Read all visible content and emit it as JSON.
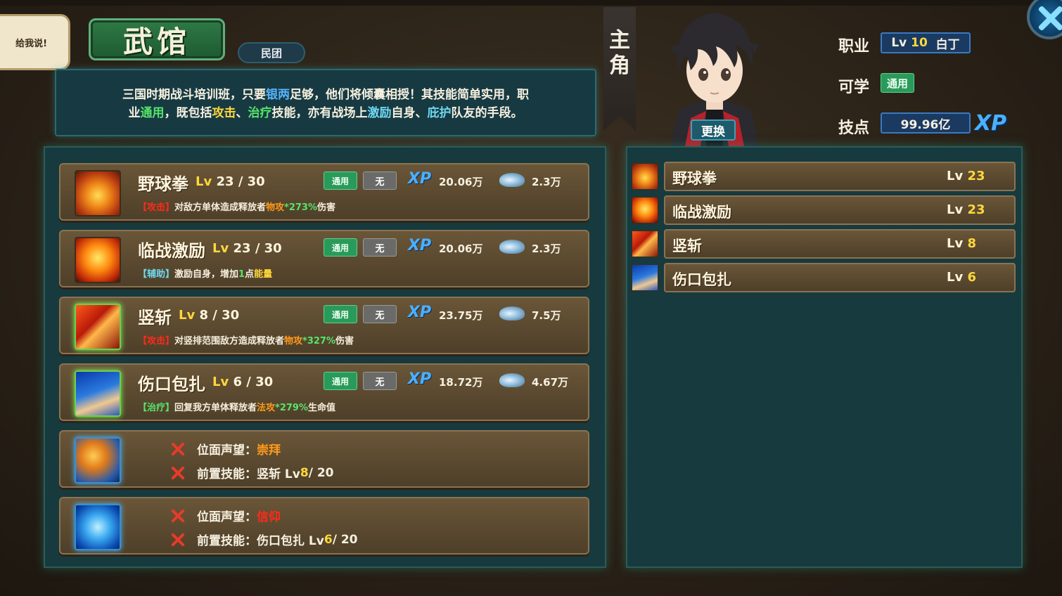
{
  "bubble_text": "给我说!",
  "title": "武馆",
  "faction": "民团",
  "description": {
    "l1_a": "三国时期战斗培训班，只要",
    "l1_b": "银两",
    "l1_c": "足够，他们将倾囊相授！其技能简单实用，职",
    "l2_a": "业",
    "l2_b": "通用",
    "l2_c": "，既包括",
    "l2_d": "攻击",
    "l2_e": "、",
    "l2_f": "治疗",
    "l2_g": "技能，亦有战场上",
    "l2_h": "激励",
    "l2_i": "自身、",
    "l2_j": "庇护",
    "l2_k": "队友的手段。"
  },
  "skills": [
    {
      "name": "野球拳",
      "lv_label": "Lv",
      "lv_cur": "23",
      "lv_sep": " / ",
      "lv_max": "30",
      "tag1": "通用",
      "tag2": "无",
      "xp_glyph": "XP",
      "xp_cost": "20.06万",
      "silver_cost": "2.3万",
      "desc_type": "【攻击】",
      "desc_a": "对敌方单体造成释放者",
      "desc_b": "物攻",
      "desc_c": "*273%",
      "desc_d": "伤害",
      "icon": "fist-fire-icon"
    },
    {
      "name": "临战激励",
      "lv_label": "Lv",
      "lv_cur": "23",
      "lv_sep": " / ",
      "lv_max": "30",
      "tag1": "通用",
      "tag2": "无",
      "xp_glyph": "XP",
      "xp_cost": "20.06万",
      "silver_cost": "2.3万",
      "desc_type": "【辅助】",
      "desc_a": "激励自身，增加",
      "desc_b": "1",
      "desc_c": "点",
      "desc_d": "能量",
      "icon": "rage-face-icon"
    },
    {
      "name": "竖斩",
      "lv_label": "Lv",
      "lv_cur": "8",
      "lv_sep": " / ",
      "lv_max": "30",
      "tag1": "通用",
      "tag2": "无",
      "xp_glyph": "XP",
      "xp_cost": "23.75万",
      "silver_cost": "7.5万",
      "desc_type": "【攻击】",
      "desc_a": "对竖排范围敌方造成释放者",
      "desc_b": "物攻",
      "desc_c": "*327%",
      "desc_d": "伤害",
      "icon": "blade-slash-icon"
    },
    {
      "name": "伤口包扎",
      "lv_label": "Lv",
      "lv_cur": "6",
      "lv_sep": " / ",
      "lv_max": "30",
      "tag1": "通用",
      "tag2": "无",
      "xp_glyph": "XP",
      "xp_cost": "18.72万",
      "silver_cost": "4.67万",
      "desc_type": "【治疗】",
      "desc_a": "回复我方单体释放者",
      "desc_b": "法攻",
      "desc_c": "*279%",
      "desc_d": "生命值",
      "icon": "bandage-hand-icon"
    }
  ],
  "locked": [
    {
      "req1_label": "位面声望：",
      "req1_val": "崇拜",
      "req2_label": "前置技能：竖斩 Lv ",
      "req2_cur": "8",
      "req2_rest": " / 20",
      "icon": "spear-strike-icon"
    },
    {
      "req1_label": "位面声望：",
      "req1_val": "信仰",
      "req2_label": "前置技能：伤口包扎 Lv ",
      "req2_cur": "6",
      "req2_rest": " / 20",
      "icon": "frost-sigil-icon"
    }
  ],
  "character": {
    "tab_label_1": "主",
    "tab_label_2": "角",
    "swap_label": "更换",
    "class_label": "职业",
    "class_lv_label": "Lv",
    "class_lv": "10",
    "class_name": "白丁",
    "learnable_label": "可学",
    "learnable_val": "通用",
    "skillpoint_label": "技点",
    "skillpoint_val": "99.96亿",
    "xp_glyph": "XP"
  },
  "equipped": [
    {
      "name": "野球拳",
      "lv_label": "Lv ",
      "lv": "23",
      "icon": "fist-fire-icon"
    },
    {
      "name": "临战激励",
      "lv_label": "Lv ",
      "lv": "23",
      "icon": "rage-face-icon"
    },
    {
      "name": "竖斩",
      "lv_label": "Lv ",
      "lv": "8",
      "icon": "blade-slash-icon"
    },
    {
      "name": "伤口包扎",
      "lv_label": "Lv ",
      "lv": "6",
      "icon": "bandage-hand-icon"
    }
  ]
}
